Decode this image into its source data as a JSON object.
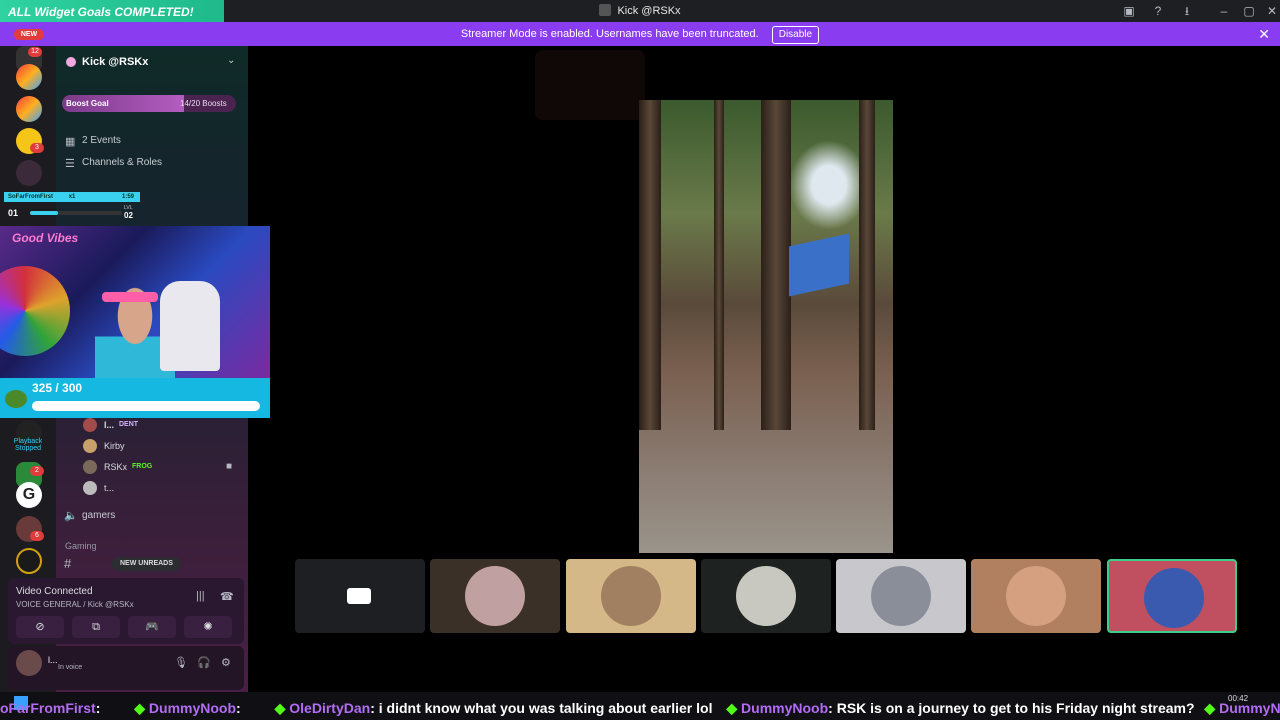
{
  "title_bar": {
    "widget_banner": "ALL Widget Goals COMPLETED! Thank You!",
    "window_title": "Kick @RSKx"
  },
  "streamer_mode": {
    "message": "Streamer Mode is enabled. Usernames have been truncated.",
    "disable_label": "Disable"
  },
  "server_rail": {
    "new_label": "NEW",
    "badges": [
      "12",
      "3",
      "2",
      "6"
    ]
  },
  "sidebar": {
    "server_name": "Kick @RSKx",
    "boost_goal_label": "Boost Goal",
    "boost_count": "14/20 Boosts",
    "boost_progress": 0.7,
    "events": "2 Events",
    "channels_roles": "Channels & Roles",
    "playback": "Playback Stopped",
    "voice_users": [
      {
        "name": "l...",
        "tag": "DENT"
      },
      {
        "name": "Kirby",
        "tag": ""
      },
      {
        "name": "RSKx",
        "tag": "FROG"
      },
      {
        "name": "t...",
        "tag": ""
      }
    ],
    "channel_gamers": "gamers",
    "category_gaming": "Gaming",
    "new_unreads": "NEW UNREADS"
  },
  "overlay": {
    "player": "SoFarFromFirst",
    "multiplier": "x1",
    "timer": "1:59",
    "level_left": "01",
    "level_right": "02",
    "level_caption": "LVL",
    "sign": "Good Vibes",
    "sub_goal": "325 / 300",
    "sub_progress": 1.0
  },
  "voice_panel": {
    "status": "Video Connected",
    "channel": "VOICE GENERAL / Kick @RSKx"
  },
  "user_panel": {
    "name": "l...",
    "status": "In voice"
  },
  "ticker": {
    "segments": [
      {
        "user": "oFarFromFirst",
        "text": ":"
      },
      {
        "user": "DummyNoob",
        "text": ":"
      },
      {
        "user": "OleDirtyDan",
        "text": ": i didnt know what you was talking about earlier lol"
      },
      {
        "user": "DummyNoob",
        "text": ": RSK is on a journey to get to his Friday night stream?"
      },
      {
        "user": "DummyNoob",
        "text": ":"
      }
    ]
  },
  "clock": "00:42",
  "colors": {
    "streamer_bar": "#8a3cf0",
    "accent_green": "#53fc18",
    "sub_goal": "#14b8e0"
  }
}
